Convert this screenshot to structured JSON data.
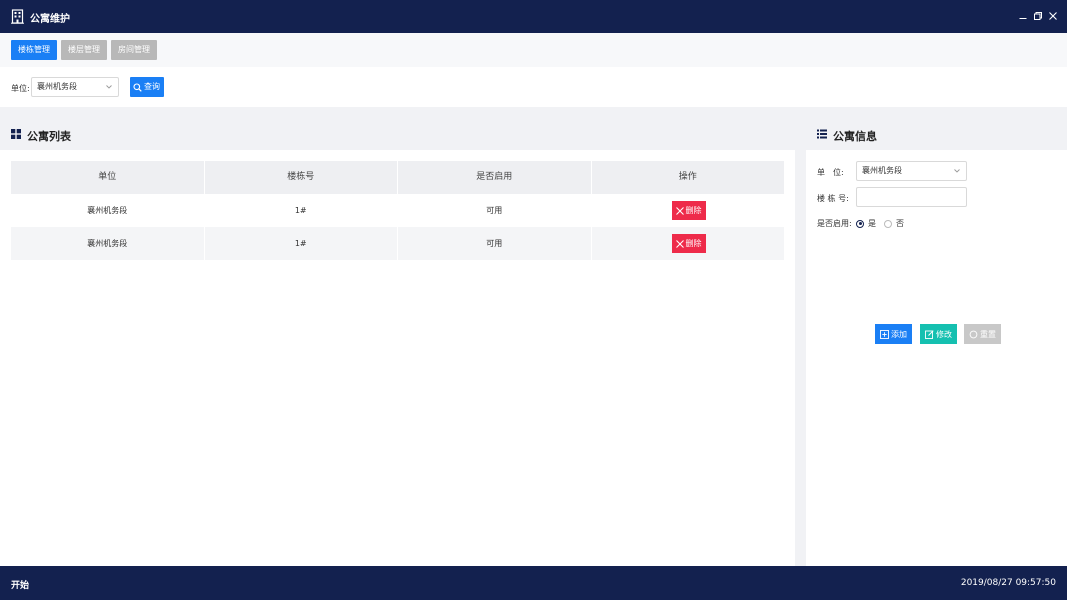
{
  "window": {
    "title": "公寓维护"
  },
  "tabs": [
    {
      "label": "楼栋管理",
      "active": true
    },
    {
      "label": "楼层管理",
      "active": false
    },
    {
      "label": "房间管理",
      "active": false
    }
  ],
  "filter": {
    "unit_label": "单位:",
    "unit_value": "襄州机务段",
    "query_label": "查询"
  },
  "list_panel": {
    "title": "公寓列表",
    "columns": [
      "单位",
      "楼栋号",
      "是否启用",
      "操作"
    ],
    "rows": [
      {
        "unit": "襄州机务段",
        "building": "1#",
        "enabled": "可用",
        "action": "删除"
      },
      {
        "unit": "襄州机务段",
        "building": "1#",
        "enabled": "可用",
        "action": "删除"
      }
    ]
  },
  "info_panel": {
    "title": "公寓信息",
    "unit_label": "单　位:",
    "unit_value": "襄州机务段",
    "building_label": "楼 栋 号:",
    "building_value": "",
    "enabled_label": "是否启用:",
    "enabled_yes": "是",
    "enabled_no": "否",
    "enabled_selected": "是",
    "add_label": "添加",
    "edit_label": "修改",
    "reset_label": "重置"
  },
  "taskbar": {
    "start_label": "开始",
    "datetime": "2019/08/27  09:57:50"
  },
  "colors": {
    "navy": "#13214f",
    "primary": "#1a7ff5",
    "danger": "#ee2b4a",
    "teal": "#15c0b0",
    "disabled": "#c8c8c8"
  }
}
